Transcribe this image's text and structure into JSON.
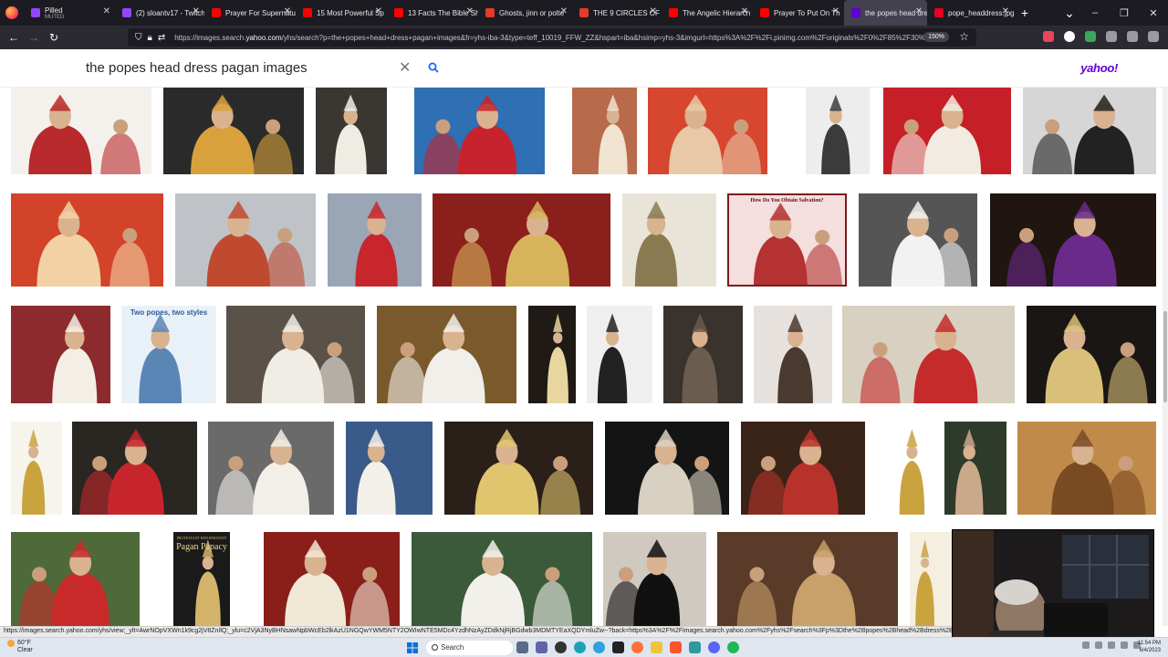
{
  "browser": {
    "tabs": [
      {
        "label": "Pilled",
        "sublabel": "MUTED",
        "icon_color": "#9147ff",
        "active": false
      },
      {
        "label": "(2) sloantv17 - Twitch",
        "icon_color": "#9147ff",
        "active": false
      },
      {
        "label": "Prayer For Supernatu",
        "icon_color": "#ff0000",
        "active": false
      },
      {
        "label": "15 Most Powerful Sp",
        "icon_color": "#ff0000",
        "active": false
      },
      {
        "label": "13 Facts The Bible Sh",
        "icon_color": "#ff0000",
        "active": false
      },
      {
        "label": "Ghosts, jinn or polte",
        "icon_color": "#e23d28",
        "active": false
      },
      {
        "label": "THE 9 CIRCLES OF H",
        "icon_color": "#e23d28",
        "active": false
      },
      {
        "label": "The Angelic Hierarch",
        "icon_color": "#ff0000",
        "active": false
      },
      {
        "label": "Prayer To Put On Th",
        "icon_color": "#ff0000",
        "active": false
      },
      {
        "label": "the popes head dres",
        "icon_color": "#6001d2",
        "active": true
      },
      {
        "label": "pope_headdress.jpg",
        "icon_color": "#e60023",
        "active": false
      }
    ],
    "new_tab": "+",
    "tab_list": "⌄",
    "window_controls": {
      "minimize": "–",
      "restore": "❐",
      "close": "✕"
    },
    "nav": {
      "back": "←",
      "forward": "→",
      "reload": "↻"
    },
    "url": {
      "prefix": "https://images.search.",
      "domain": "yahoo.com",
      "rest": "/yhs/search?p=the+popes+head+dress+pagan+images&fr=yhs-iba-3&type=teff_10019_FFW_ZZ&hspart=iba&hsimp=yhs-3&imgurl=https%3A%2F%2Fi.pinimg.com%2Foriginals%2F0%2F85%2F30%2FF"
    },
    "zoom": "150%"
  },
  "search": {
    "query": "the popes head dress pagan images",
    "brand": "yahoo!"
  },
  "status_link": "https://images.search.yahoo.com/yhs/view;_ylt=AwrNOpVXWn1k9cg2jV8ZnIlQ;_ylu=c2VjA3NyBHNsawNpbWcEb2lkAzU1NGQwYWM5NTY2OWIwNTE5MDc4YzdhNzAyZDdkNjRjBGdwb3MDMTYEaXQDYmluZw--?back=https%3A%2F%2Fimages.search.yahoo.com%2Fyhs%2Fsearch%3Fp%3Dthe%2Bpopes%2Bhead%2Bdress%2Bpagan%2Bimages&fr=yhs-iba-3#id=16&iurl=... 0&tn=&tab=organic&sigr=eIBbw11vNNaS&sigit=tkhHDkFAz0O2&sigi=L425T.rok2pT&sigt=nX.gF5YjNLlN9.crumb=Wrz4cxdv",
  "images": [
    {
      "name": "pope-cardinals-photo",
      "c1": "#f4f1ec",
      "c2": "#b82a2c"
    },
    {
      "name": "pope-swiss-guard-photo",
      "c1": "#2a2a2a",
      "c2": "#d8a13c"
    },
    {
      "name": "pope-white-robe-photo",
      "c1": "#3a3632",
      "c2": "#efece4"
    },
    {
      "name": "pope-blessing-tribesman-photo",
      "c1": "#2f6fb3",
      "c2": "#c7232c"
    },
    {
      "name": "bishop-vestments-photo",
      "c1": "#b96a4a",
      "c2": "#f0e3d0"
    },
    {
      "name": "red-vestments-altar-photo",
      "c1": "#d7462f",
      "c2": "#e8c8a6"
    },
    {
      "name": "carved-relief-bw",
      "c1": "#ededed",
      "c2": "#3b3b3b"
    },
    {
      "name": "cardinals-red-ceremony-photo",
      "c1": "#c61f27",
      "c2": "#f1ebe2"
    },
    {
      "name": "pope-tiara-bw-photo",
      "c1": "#d6d6d6",
      "c2": "#222222"
    },
    {
      "name": "native-headdress-man-photo",
      "c1": "#d2432a",
      "c2": "#f2d2a4"
    },
    {
      "name": "st-peters-headdress-photo",
      "c1": "#bfc3c7",
      "c2": "#c04a30"
    },
    {
      "name": "pope-red-cape-photo",
      "c1": "#9aa6b6",
      "c2": "#c7262d"
    },
    {
      "name": "gold-mitres-collage",
      "c1": "#8b1f1b",
      "c2": "#d7b45b"
    },
    {
      "name": "white-vestment-collage",
      "c1": "#e8e4d8",
      "c2": "#8a7a52"
    },
    {
      "name": "salvation-poster",
      "c1": "#f4dede",
      "c2": "#b43232"
    },
    {
      "name": "pope-white-standing-photo",
      "c1": "#555555",
      "c2": "#f2f2f2"
    },
    {
      "name": "pope-gold-mitre-purple-photo",
      "c1": "#201510",
      "c2": "#6a2a8a"
    },
    {
      "name": "pope-procession-photo",
      "c1": "#8c2a2e",
      "c2": "#f3efe6"
    },
    {
      "name": "two-popes-two-styles-infographic",
      "c1": "#e9f1f8",
      "c2": "#5a86b6"
    },
    {
      "name": "pope-benedict-smiling-photo",
      "c1": "#5a5248",
      "c2": "#f0ede6"
    },
    {
      "name": "pope-statue-photo",
      "c1": "#7a5a2c",
      "c2": "#f1efea"
    },
    {
      "name": "pope-gold-mitre-closeup",
      "c1": "#1f1a16",
      "c2": "#e8d6a0"
    },
    {
      "name": "dark-headdress-woman-photo",
      "c1": "#efefef",
      "c2": "#222222"
    },
    {
      "name": "beaded-veil-photo",
      "c1": "#3a322c",
      "c2": "#6a5c4e"
    },
    {
      "name": "woman-veil-portrait",
      "c1": "#e6e1dc",
      "c2": "#4a3a30"
    },
    {
      "name": "pope-kneeling-photo",
      "c1": "#d8d0c0",
      "c2": "#c52b2b"
    },
    {
      "name": "three-mitres-photo",
      "c1": "#1a1613",
      "c2": "#d9c07a"
    },
    {
      "name": "papal-tiara-gold-photo",
      "c1": "#f7f4ec",
      "c2": "#c9a33e"
    },
    {
      "name": "tribal-headdress-cardinal-photo",
      "c1": "#2a2622",
      "c2": "#c6262b"
    },
    {
      "name": "pope-francis-madonna-photo",
      "c1": "#6a6a6a",
      "c2": "#f2efe8"
    },
    {
      "name": "pope-gold-mitre-blue-photo",
      "c1": "#3a5a8a",
      "c2": "#f3f0ea"
    },
    {
      "name": "pope-gold-mitre-waving-photo",
      "c1": "#2b1f1a",
      "c2": "#e0c46e"
    },
    {
      "name": "pope-meeting-tribe-photo",
      "c1": "#141414",
      "c2": "#d8d0c0"
    },
    {
      "name": "native-dancers-photo",
      "c1": "#3a2418",
      "c2": "#b8322c"
    },
    {
      "name": "papal-emblem-gold",
      "c1": "#ffffff",
      "c2": "#c9a33e"
    },
    {
      "name": "tribal-shaman-photo",
      "c1": "#2e3a2a",
      "c2": "#caa88a"
    },
    {
      "name": "renaissance-painting",
      "c1": "#c08a4a",
      "c2": "#7a4a22"
    },
    {
      "name": "pope-receiving-gift-photo",
      "c1": "#4f6a3a",
      "c2": "#c82a2a"
    },
    {
      "name": "pagan-papacy-book-cover",
      "c1": "#1a1a1a",
      "c2": "#d4b46a"
    },
    {
      "name": "pope-ceremony-gold-photo",
      "c1": "#8a1f1a",
      "c2": "#f1e8d6"
    },
    {
      "name": "pope-greeting-children-photo",
      "c1": "#3a5a3a",
      "c2": "#f2f0ea"
    },
    {
      "name": "pope-meeting-president-photo",
      "c1": "#cfc9c0",
      "c2": "#111111"
    },
    {
      "name": "crowd-ceremony-photo",
      "c1": "#5a3a28",
      "c2": "#c8a06a"
    },
    {
      "name": "gold-mitre-partial",
      "c1": "#f5efe0",
      "c2": "#c9a33e"
    }
  ],
  "infographic": {
    "title": "Two popes, two styles"
  },
  "book_cover": {
    "small": "PROTESTANT REFORMATION",
    "title": "Pagan Papacy"
  },
  "poster": {
    "title": "How Do You Obtain Salvation?"
  },
  "taskbar": {
    "temp": "60°F",
    "weather": "Clear",
    "search_label": "Search",
    "time": "11:54 PM",
    "date": "6/4/2023"
  }
}
